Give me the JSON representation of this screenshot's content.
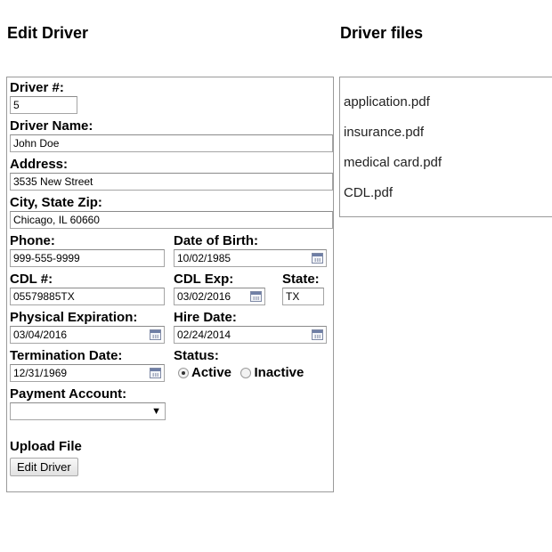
{
  "headings": {
    "edit": "Edit Driver",
    "files": "Driver files"
  },
  "form": {
    "driver_num": {
      "label": "Driver #:",
      "value": "5"
    },
    "driver_name": {
      "label": "Driver Name:",
      "value": "John Doe"
    },
    "address": {
      "label": "Address:",
      "value": "3535 New Street"
    },
    "city_state_zip": {
      "label": "City, State Zip:",
      "value": "Chicago, IL 60660"
    },
    "phone": {
      "label": "Phone:",
      "value": "999-555-9999"
    },
    "dob": {
      "label": "Date of Birth:",
      "value": "10/02/1985"
    },
    "cdl_num": {
      "label": "CDL #:",
      "value": "05579885TX"
    },
    "cdl_exp": {
      "label": "CDL Exp:",
      "value": "03/02/2016"
    },
    "state": {
      "label": "State:",
      "value": "TX"
    },
    "physical_exp": {
      "label": "Physical Expiration:",
      "value": "03/04/2016"
    },
    "hire_date": {
      "label": "Hire Date:",
      "value": "02/24/2014"
    },
    "termination_date": {
      "label": "Termination Date:",
      "value": "12/31/1969"
    },
    "status": {
      "label": "Status:",
      "options": [
        "Active",
        "Inactive"
      ],
      "selected": "Active"
    },
    "payment_account": {
      "label": "Payment Account:",
      "value": ""
    },
    "upload": {
      "label": "Upload File"
    },
    "submit_label": "Edit Driver"
  },
  "files": [
    "application.pdf",
    "insurance.pdf",
    "medical card.pdf",
    "CDL.pdf"
  ]
}
